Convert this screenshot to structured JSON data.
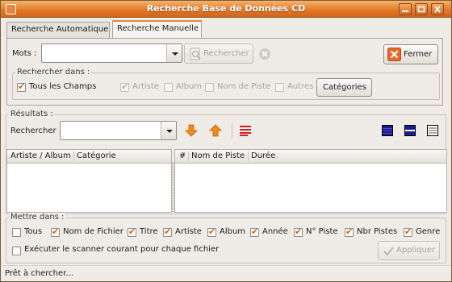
{
  "window": {
    "title": "Recherche Base de Données CD"
  },
  "tabs": [
    {
      "label": "Recherche Automatique"
    },
    {
      "label": "Recherche Manuelle"
    }
  ],
  "search": {
    "mots_label": "Mots :",
    "mots_value": "",
    "search_button": "Rechercher",
    "close_button": "Fermer",
    "rechercher_dans": "Rechercher dans :",
    "tous_les_champs": "Tous les Champs",
    "fields": [
      "Artiste",
      "Album",
      "Nom de Piste",
      "Autres"
    ],
    "categories_button": "Catégories"
  },
  "results": {
    "frame_label": "Résultats :",
    "rechercher_label": "Rechercher :",
    "left_columns": [
      "Artiste / Album",
      "Catégorie"
    ],
    "right_columns": [
      "#",
      "Nom de Piste",
      "Durée"
    ]
  },
  "mettre_dans": {
    "frame_label": "Mettre dans :",
    "options": [
      "Tous",
      "Nom de Fichier",
      "Titre",
      "Artiste",
      "Album",
      "Année",
      "N° Piste",
      "Nbr Pistes",
      "Genre"
    ],
    "scanner_label": "Exécuter le scanner courant pour chaque fichier",
    "apply_button": "Appliquer"
  },
  "status": {
    "text": "Prêt à chercher..."
  },
  "colors": {
    "accent": "#e37a2a",
    "close_icon": "#e8692a",
    "arrow_icon": "#f08a18",
    "list_icon": "#d02020",
    "view_icon": "#1a1a8c"
  }
}
